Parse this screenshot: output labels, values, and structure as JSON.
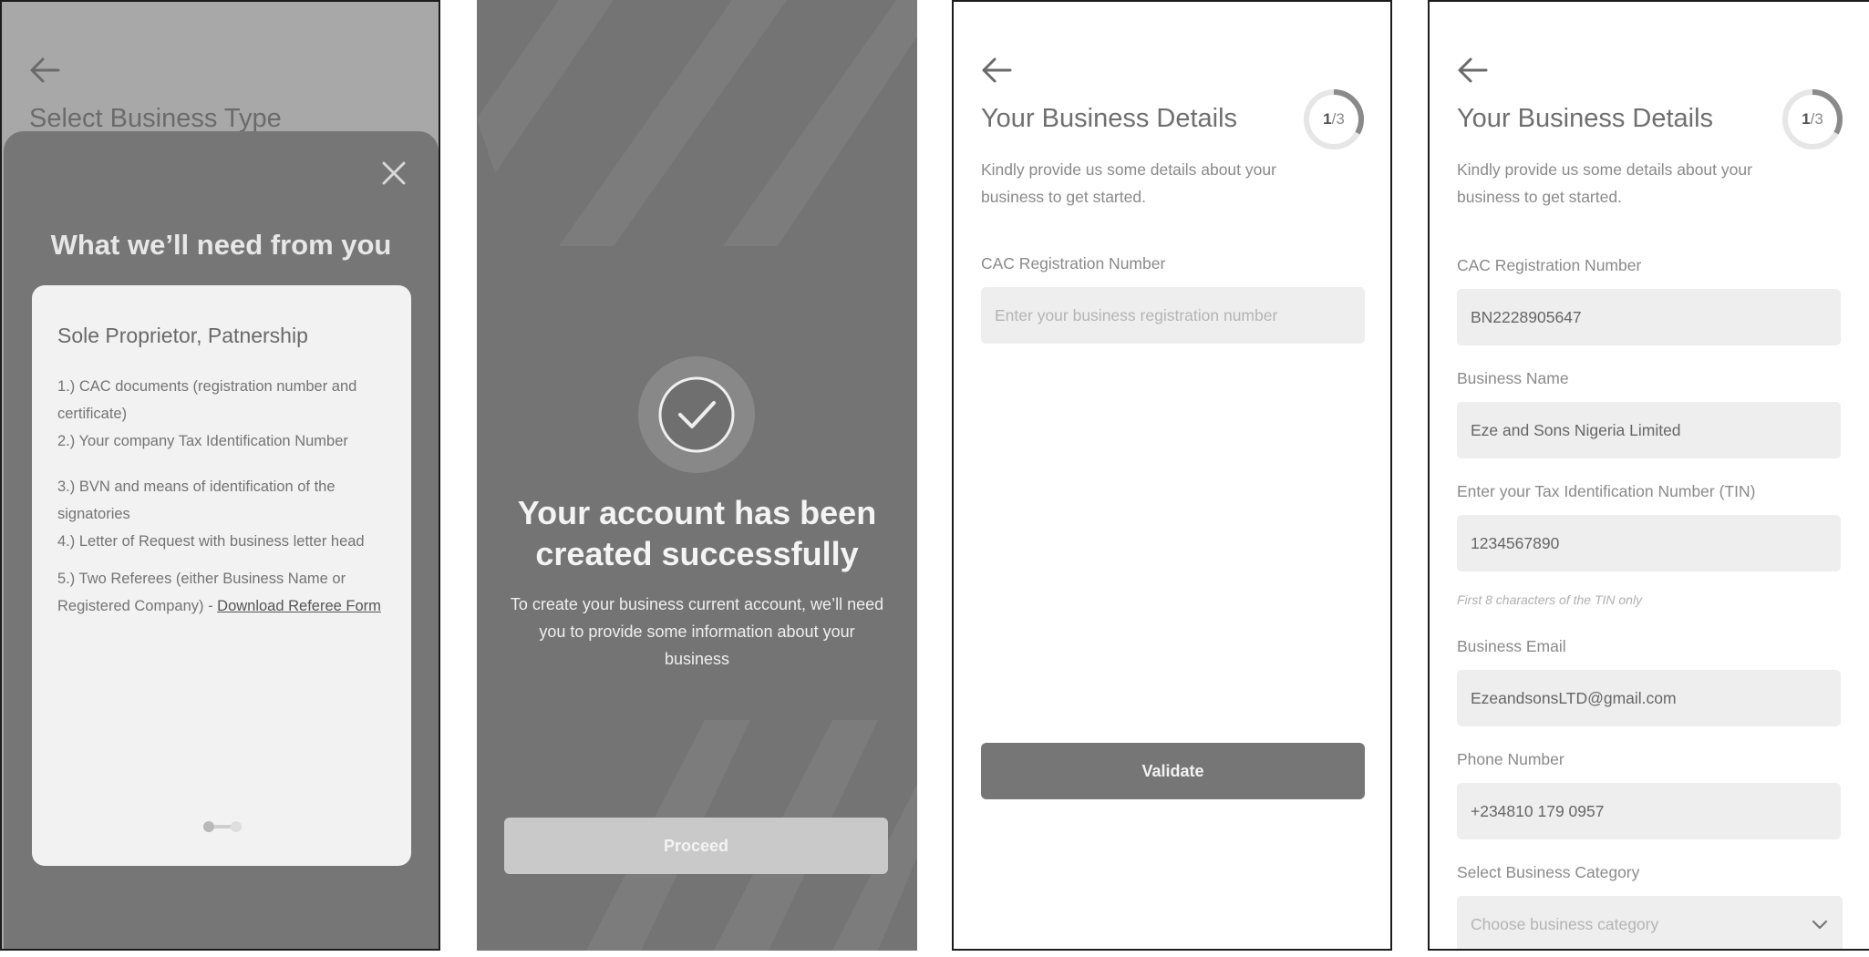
{
  "screen1": {
    "title": "Select Business Type",
    "sheet_title": "What we’ll need from you",
    "card_title": "Sole Proprietor, Patnership",
    "requirements": [
      "1.) CAC documents (registration number and certificate)",
      "2.) Your company Tax Identification Number",
      "3.) BVN and means of identification of the signatories",
      "4.) Letter of Request with business letter head",
      "5.) Two Referees (either Business Name or Registered Company) - "
    ],
    "download_link": "Download Referee Form"
  },
  "screen2": {
    "title": "Your account has been created successfully",
    "message": "To create your business current account, we’ll need you to provide some information about your business",
    "proceed_label": "Proceed"
  },
  "screen3": {
    "title": "Your Business Details",
    "step_current": "1",
    "step_total": "/3",
    "subtitle": "Kindly provide us some details about your business to get started.",
    "cac_label": "CAC Registration Number",
    "cac_placeholder": "Enter your business registration number",
    "validate_label": "Validate"
  },
  "screen4": {
    "title": "Your Business Details",
    "step_current": "1",
    "step_total": "/3",
    "subtitle": "Kindly provide us some details about your business to get started.",
    "fields": [
      {
        "label": "CAC Registration Number",
        "value": "BN2228905647"
      },
      {
        "label": "Business Name",
        "value": "Eze and Sons Nigeria Limited"
      },
      {
        "label": "Enter your Tax Identification Number (TIN)",
        "value": "1234567890"
      },
      {
        "label": "Business Email",
        "value": "EzeandsonsLTD@gmail.com"
      },
      {
        "label": "Phone Number",
        "value": "+234810 179 0957"
      }
    ],
    "tin_hint": "First 8 characters of the TIN only",
    "category_label": "Select Business Category",
    "category_placeholder": "Choose business category"
  },
  "progress_fraction": 0.333,
  "colors": {
    "overlay": "#a8a8a8",
    "sheet": "#767676",
    "button_dark": "#767676",
    "button_disabled": "#c9c9c9",
    "field_bg": "#eeeeee"
  }
}
